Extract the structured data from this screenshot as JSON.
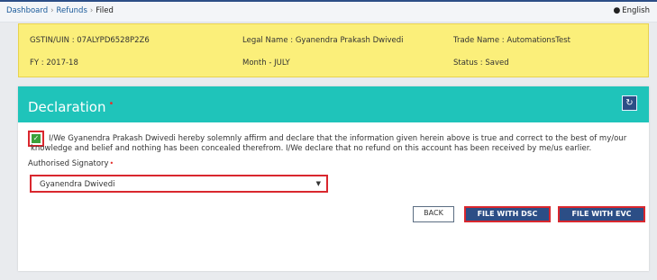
{
  "breadcrumb": {
    "items": [
      "Dashboard",
      "Refunds",
      "Filed"
    ],
    "separator": "›"
  },
  "language": {
    "label": "English"
  },
  "info": {
    "gstin": "GSTIN/UIN : 07ALYPD6528P2Z6",
    "legal_name": "Legal Name : Gyanendra Prakash Dwivedi",
    "trade_name": "Trade Name : AutomationsTest",
    "fy": "FY : 2017-18",
    "month": "Month - JULY",
    "status": "Status : Saved"
  },
  "declaration": {
    "title": "Declaration",
    "required_mark": "•",
    "checkbox_checked": true,
    "text": "I/We Gyanendra Prakash Dwivedi hereby solemnly affirm and declare that the information given herein above is true and correct to the best of my/our knowledge and belief and nothing has been concealed therefrom. I/We declare that no refund on this account has been received by me/us earlier.",
    "signatory_label": "Authorised Signatory",
    "signatory_value": "Gyanendra Dwivedi"
  },
  "buttons": {
    "back": "BACK",
    "file_dsc": "FILE WITH DSC",
    "file_evc": "FILE WITH EVC"
  },
  "colors": {
    "header": "#1fc4ba",
    "infobar": "#fbef7a",
    "primary": "#2c4e86",
    "highlight": "#d9272e"
  }
}
